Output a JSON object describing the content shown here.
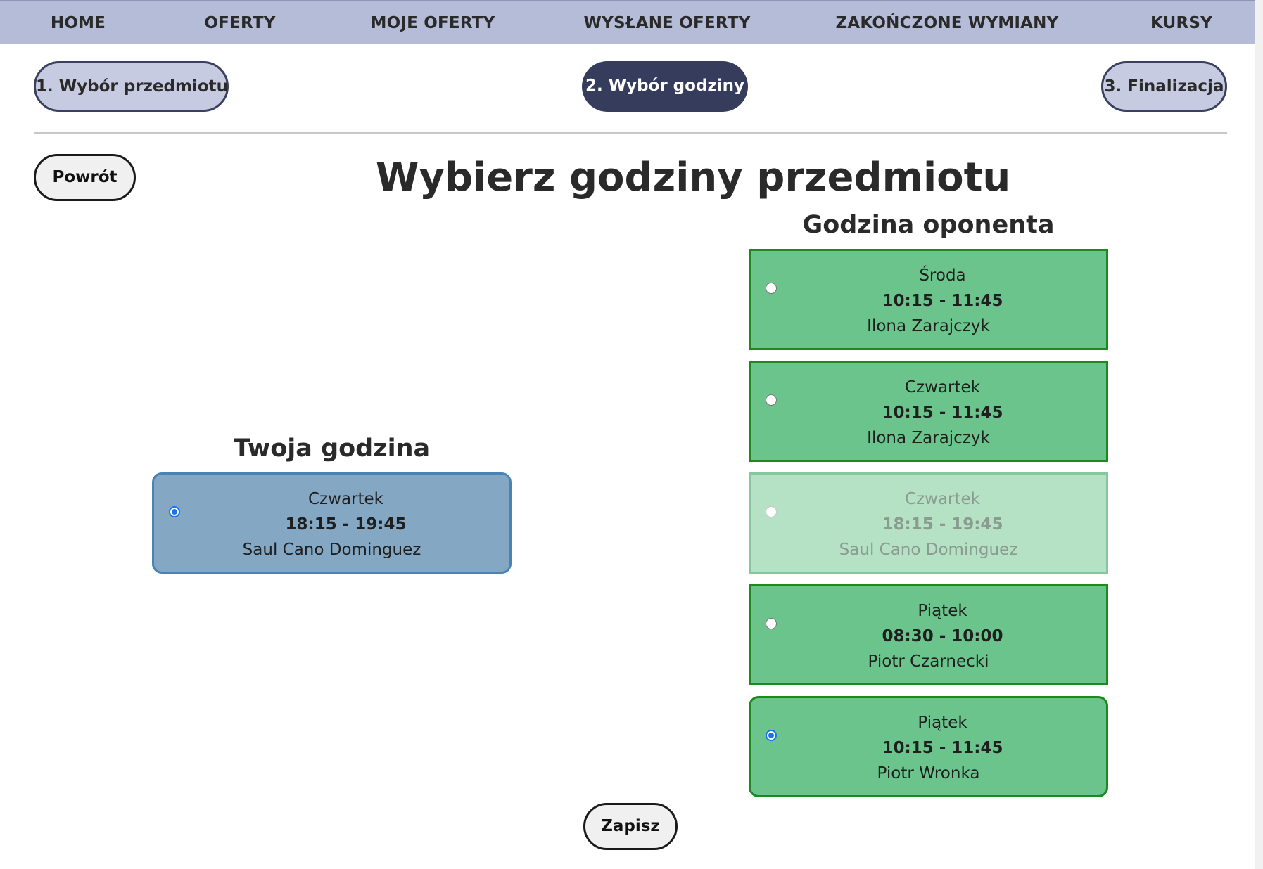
{
  "nav": {
    "items": [
      {
        "label": "HOME"
      },
      {
        "label": "OFERTY"
      },
      {
        "label": "MOJE OFERTY"
      },
      {
        "label": "WYSŁANE OFERTY"
      },
      {
        "label": "ZAKOŃCZONE WYMIANY"
      },
      {
        "label": "KURSY"
      }
    ]
  },
  "steps": [
    {
      "label": "1. Wybór przedmiotu",
      "state": "done"
    },
    {
      "label": "2. Wybór godziny",
      "state": "active"
    },
    {
      "label": "3. Finalizacja",
      "state": "pending"
    }
  ],
  "back_label": "Powrót",
  "page_title": "Wybierz godziny przedmiotu",
  "mine": {
    "title": "Twoja godzina",
    "slot": {
      "day": "Czwartek",
      "time": "18:15 - 19:45",
      "person": "Saul Cano Dominguez",
      "selected": true
    }
  },
  "opponent": {
    "title": "Godzina oponenta",
    "slots": [
      {
        "day": "Środa",
        "time": "10:15 - 11:45",
        "person": "Ilona Zarajczyk",
        "selected": false,
        "disabled": false
      },
      {
        "day": "Czwartek",
        "time": "10:15 - 11:45",
        "person": "Ilona Zarajczyk",
        "selected": false,
        "disabled": false
      },
      {
        "day": "Czwartek",
        "time": "18:15 - 19:45",
        "person": "Saul Cano Dominguez",
        "selected": false,
        "disabled": true
      },
      {
        "day": "Piątek",
        "time": "08:30 - 10:00",
        "person": "Piotr Czarnecki",
        "selected": false,
        "disabled": false
      },
      {
        "day": "Piątek",
        "time": "10:15 - 11:45",
        "person": "Piotr Wronka",
        "selected": true,
        "disabled": false
      }
    ]
  },
  "save_label": "Zapisz",
  "colors": {
    "nav_bg": "#b5bcd8",
    "step_active_bg": "#363d5c",
    "step_idle_bg": "#c6cbe2",
    "mine_slot_bg": "#84a8c4",
    "opp_slot_bg": "#6bc48c",
    "opp_slot_disabled_bg": "#b5e1c4",
    "radio_selected": "#1a73e8"
  }
}
